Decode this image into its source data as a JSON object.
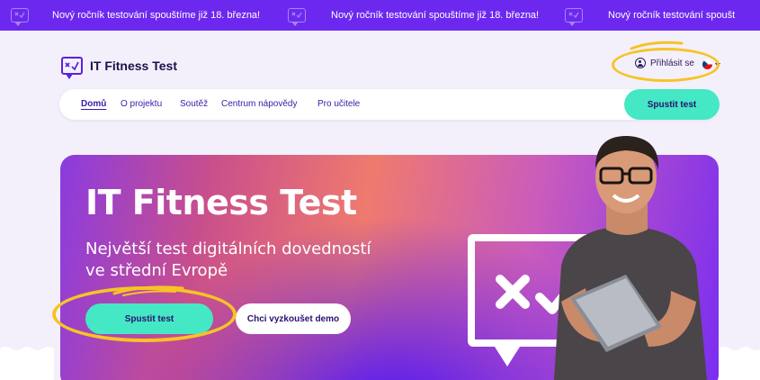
{
  "banner": {
    "message": "Nový ročník testování spouštíme již 18. března!",
    "message_truncated": "Nový ročník testování spoušt"
  },
  "header": {
    "logo_text": "IT Fitness Test",
    "login_label": "Přihlásit se"
  },
  "nav": {
    "items": [
      {
        "label": "Domů",
        "active": true
      },
      {
        "label": "O projektu",
        "active": false
      },
      {
        "label": "Soutěž",
        "active": false
      },
      {
        "label": "Centrum nápovědy",
        "active": false
      },
      {
        "label": "Pro učitele",
        "active": false
      }
    ],
    "cta_label": "Spustit test"
  },
  "hero": {
    "title": "IT Fitness Test",
    "subtitle_line1": "Největší test digitálních dovedností",
    "subtitle_line2": "ve střední Evropě",
    "primary_button": "Spustit test",
    "secondary_button": "Chci vyzkoušet demo"
  },
  "colors": {
    "banner": "#6d28f0",
    "accent_cta": "#45e8c4",
    "highlight": "#f7c325",
    "nav_text": "#3b1aa8",
    "background": "#f3f0fb"
  },
  "icons": {
    "banner": "chat-check-icon",
    "logo": "chat-check-icon",
    "login": "user-circle-icon",
    "language": "czech-flag-icon"
  }
}
